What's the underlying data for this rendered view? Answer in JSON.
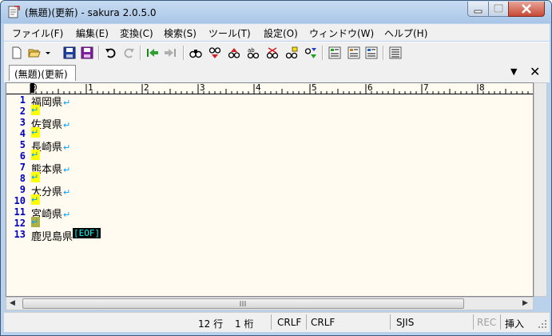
{
  "window": {
    "title": "(無題)(更新) - sakura 2.0.5.0"
  },
  "menu": {
    "items": [
      "ファイル(F)",
      "編集(E)",
      "変換(C)",
      "検索(S)",
      "ツール(T)",
      "設定(O)",
      "ウィンドウ(W)",
      "ヘルプ(H)"
    ]
  },
  "toolbar": {
    "icons": [
      "new-file-icon",
      "open-file-icon",
      "open-dropdown-icon",
      "save-icon",
      "save-all-icon",
      "undo-icon",
      "redo-icon",
      "jump-back-icon",
      "jump-forward-icon",
      "search-icon",
      "find-next-icon",
      "find-prev-icon",
      "replace-icon",
      "grep-icon",
      "bookmark-icon",
      "search-marks-icon",
      "outline-icon",
      "function-list-icon",
      "tag-jump-icon",
      "settings-icon"
    ]
  },
  "tab": {
    "label": "(無題)(更新)"
  },
  "ruler": {
    "marks": [
      "0",
      "1",
      "2",
      "3",
      "4",
      "5",
      "6",
      "7",
      "8"
    ]
  },
  "editor": {
    "lines": [
      {
        "num": "1",
        "text": "福岡県",
        "nl": "↵",
        "highlight": false
      },
      {
        "num": "2",
        "text": "",
        "nl": "↵",
        "highlight": true
      },
      {
        "num": "3",
        "text": "佐賀県",
        "nl": "↵",
        "highlight": false
      },
      {
        "num": "4",
        "text": "",
        "nl": "↵",
        "highlight": true
      },
      {
        "num": "5",
        "text": "長崎県",
        "nl": "↵",
        "highlight": false
      },
      {
        "num": "6",
        "text": "",
        "nl": "↵",
        "highlight": true
      },
      {
        "num": "7",
        "text": "熊本県",
        "nl": "↵",
        "highlight": false
      },
      {
        "num": "8",
        "text": "",
        "nl": "↵",
        "highlight": true
      },
      {
        "num": "9",
        "text": "大分県",
        "nl": "↵",
        "highlight": false
      },
      {
        "num": "10",
        "text": "",
        "nl": "↵",
        "highlight": true
      },
      {
        "num": "11",
        "text": "宮崎県",
        "nl": "↵",
        "highlight": false
      },
      {
        "num": "12",
        "text": "",
        "nl": "↵",
        "highlight": true
      },
      {
        "num": "13",
        "text": "鹿児島県",
        "nl": "",
        "highlight": false
      }
    ],
    "eof_marker": "[EOF]"
  },
  "status": {
    "line": "12 行",
    "column": "1 桁",
    "eol1": "CRLF",
    "eol2": "CRLF",
    "encoding": "SJIS",
    "rec": "REC",
    "mode": "挿入"
  },
  "colors": {
    "line_number": "#0000c0",
    "newline_mark": "#00a0ff",
    "blank_line_highlight": "#ffff00",
    "eof_bg": "#000000",
    "eof_fg": "#00ffff",
    "editor_bg": "#fffbf0"
  }
}
